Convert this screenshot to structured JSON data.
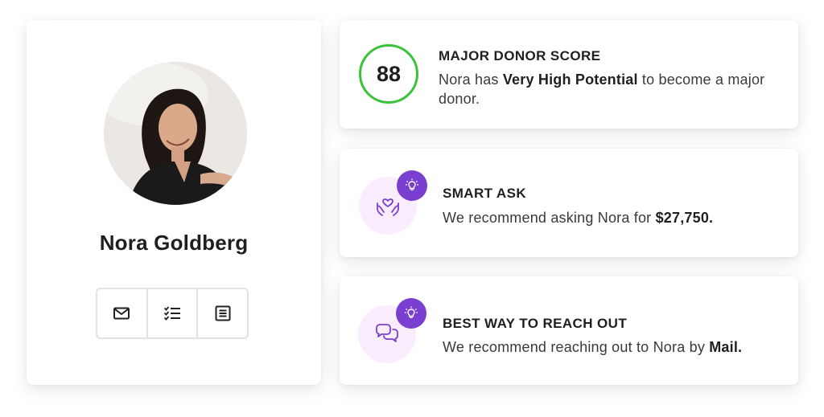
{
  "profile": {
    "name": "Nora Goldberg",
    "actions": [
      {
        "icon": "mail-icon",
        "label": "Mail"
      },
      {
        "icon": "checklist-icon",
        "label": "Tasks"
      },
      {
        "icon": "notes-icon",
        "label": "Notes"
      }
    ]
  },
  "donor_score": {
    "value": "88",
    "title": "MAJOR DONOR SCORE",
    "text_prefix": "Nora has ",
    "text_bold": "Very High Potential",
    "text_suffix": " to become a major donor.",
    "ring_color": "#3cc13b"
  },
  "smart_ask": {
    "title": "SMART ASK",
    "text_prefix": "We recommend asking Nora for ",
    "text_bold": "$27,750.",
    "icon": "hands-heart-icon",
    "badge_icon": "lightbulb-icon"
  },
  "reach_out": {
    "title": "BEST WAY TO REACH OUT",
    "text_prefix": "We recommend reaching out to Nora by ",
    "text_bold": "Mail.",
    "icon": "chat-bubbles-icon",
    "badge_icon": "lightbulb-icon"
  },
  "colors": {
    "accent_purple": "#7a3fd1",
    "icon_bg": "#f8ecfd",
    "score_green": "#3cc13b"
  }
}
